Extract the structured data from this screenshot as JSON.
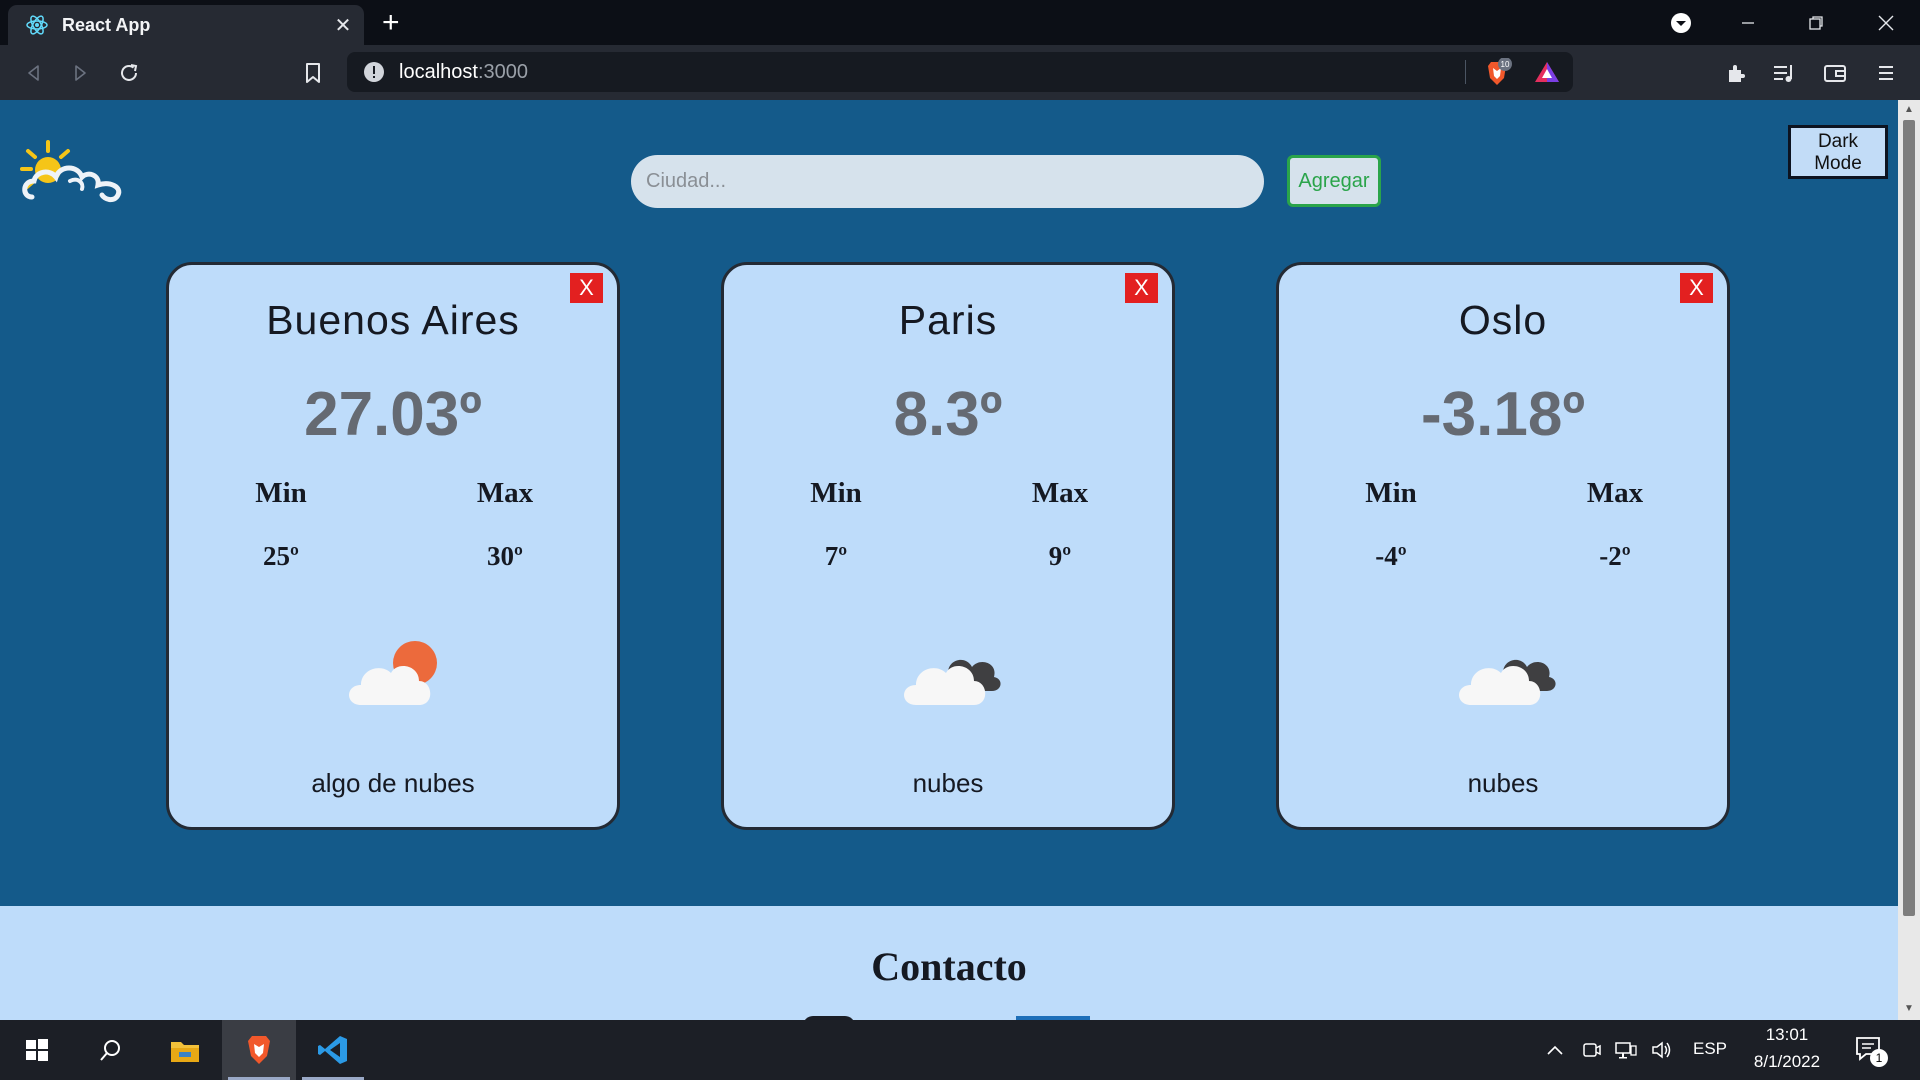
{
  "browser": {
    "tab_title": "React App",
    "new_tab": "+",
    "url_host": "localhost",
    "url_port": ":3000",
    "shield_count": "10"
  },
  "page": {
    "search_placeholder": "Ciudad...",
    "add_button": "Agregar",
    "dark_mode_line1": "Dark",
    "dark_mode_line2": "Mode",
    "close_label": "X",
    "min_label": "Min",
    "max_label": "Max",
    "cards": [
      {
        "city": "Buenos Aires",
        "temp": "27.03º",
        "min": "25º",
        "max": "30º",
        "desc": "algo de nubes",
        "icon": "cloud-sun-icon"
      },
      {
        "city": "Paris",
        "temp": "8.3º",
        "min": "7º",
        "max": "9º",
        "desc": "nubes",
        "icon": "cloud-dark-icon"
      },
      {
        "city": "Oslo",
        "temp": "-3.18º",
        "min": "-4º",
        "max": "-2º",
        "desc": "nubes",
        "icon": "cloud-dark-icon"
      }
    ],
    "contact_title": "Contacto"
  },
  "taskbar": {
    "lang": "ESP",
    "time": "13:01",
    "date": "8/1/2022",
    "notifications": "1"
  },
  "colors": {
    "page_bg": "#145a8a",
    "card_bg": "#bedcfa",
    "accent_green": "#2aa44a",
    "close_red": "#e32020"
  }
}
